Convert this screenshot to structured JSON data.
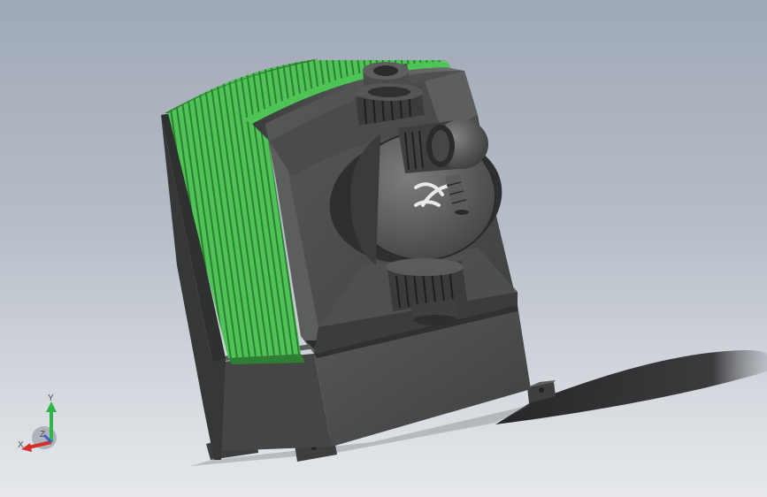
{
  "view": {
    "background_top": "#9fa9b6",
    "background_bottom": "#e6e8eb"
  },
  "model": {
    "body_color": "#4a4b4b",
    "body_dark": "#2f3030",
    "body_light": "#6b6c6c",
    "fin_color": "#4ec356",
    "fin_dark": "#2e7f34",
    "logo_mark": "x-swoosh"
  },
  "triad": {
    "y_label": "Y",
    "z_label": "Z",
    "x_label": "X",
    "y_color": "#2fb54a",
    "x_color": "#d6302c",
    "z_color": "#3d5bd6"
  }
}
